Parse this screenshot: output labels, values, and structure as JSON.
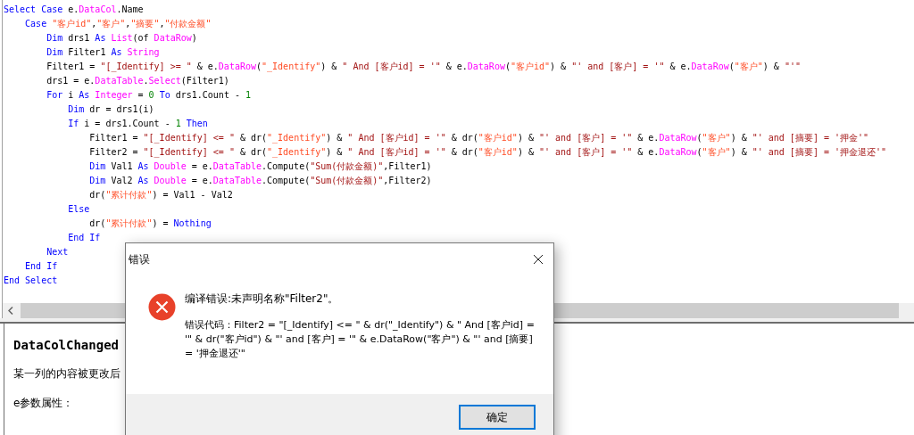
{
  "editor": {
    "lines": [
      {
        "tokens": [
          {
            "kind": "keyword",
            "text": "Select Case"
          },
          {
            "kind": "plain",
            "text": " e."
          },
          {
            "kind": "member",
            "text": "DataCol"
          },
          {
            "kind": "plain",
            "text": ".Name"
          }
        ]
      },
      {
        "tokens": [
          {
            "kind": "keyword",
            "text": "    Case "
          },
          {
            "kind": "string",
            "text": "\"客户id\""
          },
          {
            "kind": "plain",
            "text": ","
          },
          {
            "kind": "string",
            "text": "\"客户\""
          },
          {
            "kind": "plain",
            "text": ","
          },
          {
            "kind": "string",
            "text": "\"摘要\""
          },
          {
            "kind": "plain",
            "text": ","
          },
          {
            "kind": "string",
            "text": "\"付款金额\""
          }
        ]
      },
      {
        "tokens": [
          {
            "kind": "keyword",
            "text": "        Dim"
          },
          {
            "kind": "plain",
            "text": " drs1 "
          },
          {
            "kind": "keyword",
            "text": "As "
          },
          {
            "kind": "member",
            "text": "List"
          },
          {
            "kind": "plain",
            "text": "(of "
          },
          {
            "kind": "member",
            "text": "DataRow"
          },
          {
            "kind": "plain",
            "text": ")"
          }
        ]
      },
      {
        "tokens": [
          {
            "kind": "keyword",
            "text": "        Dim"
          },
          {
            "kind": "plain",
            "text": " Filter1 "
          },
          {
            "kind": "keyword",
            "text": "As "
          },
          {
            "kind": "member",
            "text": "String"
          }
        ]
      },
      {
        "tokens": [
          {
            "kind": "plain",
            "text": "        Filter1 = "
          },
          {
            "kind": "sql",
            "text": "\"[_Identify] >= \""
          },
          {
            "kind": "plain",
            "text": " & e."
          },
          {
            "kind": "member",
            "text": "DataRow"
          },
          {
            "kind": "plain",
            "text": "("
          },
          {
            "kind": "string",
            "text": "\"_Identify\""
          },
          {
            "kind": "plain",
            "text": ") & "
          },
          {
            "kind": "sql",
            "text": "\" And [客户id] = '\""
          },
          {
            "kind": "plain",
            "text": " & e."
          },
          {
            "kind": "member",
            "text": "DataRow"
          },
          {
            "kind": "plain",
            "text": "("
          },
          {
            "kind": "string",
            "text": "\"客户id\""
          },
          {
            "kind": "plain",
            "text": ") & "
          },
          {
            "kind": "sql",
            "text": "\"' and [客户] = '\""
          },
          {
            "kind": "plain",
            "text": " & e."
          },
          {
            "kind": "member",
            "text": "DataRow"
          },
          {
            "kind": "plain",
            "text": "("
          },
          {
            "kind": "string",
            "text": "\"客户\""
          },
          {
            "kind": "plain",
            "text": ") & "
          },
          {
            "kind": "sql",
            "text": "\"'\""
          }
        ]
      },
      {
        "tokens": [
          {
            "kind": "plain",
            "text": "        drs1 = e."
          },
          {
            "kind": "member",
            "text": "DataTable"
          },
          {
            "kind": "plain",
            "text": "."
          },
          {
            "kind": "member",
            "text": "Select"
          },
          {
            "kind": "plain",
            "text": "(Filter1)"
          }
        ]
      },
      {
        "tokens": [
          {
            "kind": "keyword",
            "text": "        For"
          },
          {
            "kind": "plain",
            "text": " i "
          },
          {
            "kind": "keyword",
            "text": "As "
          },
          {
            "kind": "member",
            "text": "Integer"
          },
          {
            "kind": "plain",
            "text": " = "
          },
          {
            "kind": "number",
            "text": "0 "
          },
          {
            "kind": "keyword",
            "text": "To"
          },
          {
            "kind": "plain",
            "text": " drs1.Count - "
          },
          {
            "kind": "number",
            "text": "1"
          }
        ]
      },
      {
        "tokens": [
          {
            "kind": "keyword",
            "text": "            Dim"
          },
          {
            "kind": "plain",
            "text": " dr = drs1(i)"
          }
        ]
      },
      {
        "tokens": [
          {
            "kind": "keyword",
            "text": "            If"
          },
          {
            "kind": "plain",
            "text": " i = drs1.Count - "
          },
          {
            "kind": "number",
            "text": "1 "
          },
          {
            "kind": "keyword",
            "text": "Then"
          }
        ]
      },
      {
        "tokens": [
          {
            "kind": "plain",
            "text": "                Filter1 = "
          },
          {
            "kind": "sql",
            "text": "\"[_Identify] <= \""
          },
          {
            "kind": "plain",
            "text": " & dr("
          },
          {
            "kind": "string",
            "text": "\"_Identify\""
          },
          {
            "kind": "plain",
            "text": ") & "
          },
          {
            "kind": "sql",
            "text": "\" And [客户id] = '\""
          },
          {
            "kind": "plain",
            "text": " & dr("
          },
          {
            "kind": "string",
            "text": "\"客户id\""
          },
          {
            "kind": "plain",
            "text": ") & "
          },
          {
            "kind": "sql",
            "text": "\"' and [客户] = '\""
          },
          {
            "kind": "plain",
            "text": " & e."
          },
          {
            "kind": "member",
            "text": "DataRow"
          },
          {
            "kind": "plain",
            "text": "("
          },
          {
            "kind": "string",
            "text": "\"客户\""
          },
          {
            "kind": "plain",
            "text": ") & "
          },
          {
            "kind": "sql",
            "text": "\"' and [摘要] = '押金'\""
          }
        ]
      },
      {
        "tokens": [
          {
            "kind": "plain",
            "text": "                Filter2 = "
          },
          {
            "kind": "sql",
            "text": "\"[_Identify] <= \""
          },
          {
            "kind": "plain",
            "text": " & dr("
          },
          {
            "kind": "string",
            "text": "\"_Identify\""
          },
          {
            "kind": "plain",
            "text": ") & "
          },
          {
            "kind": "sql",
            "text": "\" And [客户id] = '\""
          },
          {
            "kind": "plain",
            "text": " & dr("
          },
          {
            "kind": "string",
            "text": "\"客户id\""
          },
          {
            "kind": "plain",
            "text": ") & "
          },
          {
            "kind": "sql",
            "text": "\"' and [客户] = '\""
          },
          {
            "kind": "plain",
            "text": " & e."
          },
          {
            "kind": "member",
            "text": "DataRow"
          },
          {
            "kind": "plain",
            "text": "("
          },
          {
            "kind": "string",
            "text": "\"客户\""
          },
          {
            "kind": "plain",
            "text": ") & "
          },
          {
            "kind": "sql",
            "text": "\"' and [摘要] = '押金退还'\""
          }
        ]
      },
      {
        "tokens": [
          {
            "kind": "keyword",
            "text": "                Dim"
          },
          {
            "kind": "plain",
            "text": " Val1 "
          },
          {
            "kind": "keyword",
            "text": "As "
          },
          {
            "kind": "member",
            "text": "Double"
          },
          {
            "kind": "plain",
            "text": " = e."
          },
          {
            "kind": "member",
            "text": "DataTable"
          },
          {
            "kind": "plain",
            "text": ".Compute("
          },
          {
            "kind": "sql",
            "text": "\"Sum(付款金额)\""
          },
          {
            "kind": "plain",
            "text": ",Filter1)"
          }
        ]
      },
      {
        "tokens": [
          {
            "kind": "keyword",
            "text": "                Dim"
          },
          {
            "kind": "plain",
            "text": " Val2 "
          },
          {
            "kind": "keyword",
            "text": "As "
          },
          {
            "kind": "member",
            "text": "Double"
          },
          {
            "kind": "plain",
            "text": " = e."
          },
          {
            "kind": "member",
            "text": "DataTable"
          },
          {
            "kind": "plain",
            "text": ".Compute("
          },
          {
            "kind": "sql",
            "text": "\"Sum(付款金额)\""
          },
          {
            "kind": "plain",
            "text": ",Filter2)"
          }
        ]
      },
      {
        "tokens": [
          {
            "kind": "plain",
            "text": "                dr("
          },
          {
            "kind": "string",
            "text": "\"累计付款\""
          },
          {
            "kind": "plain",
            "text": ") = Val1 - Val2"
          }
        ]
      },
      {
        "tokens": [
          {
            "kind": "keyword",
            "text": "            Else"
          }
        ]
      },
      {
        "tokens": [
          {
            "kind": "plain",
            "text": "                dr("
          },
          {
            "kind": "string",
            "text": "\"累计付款\""
          },
          {
            "kind": "plain",
            "text": ") = "
          },
          {
            "kind": "keyword",
            "text": "Nothing"
          }
        ]
      },
      {
        "tokens": [
          {
            "kind": "keyword",
            "text": "            End If"
          }
        ]
      },
      {
        "tokens": [
          {
            "kind": "keyword",
            "text": "        Next"
          }
        ]
      },
      {
        "tokens": [
          {
            "kind": "keyword",
            "text": "    End If"
          }
        ]
      },
      {
        "tokens": [
          {
            "kind": "keyword",
            "text": "End Select"
          }
        ]
      }
    ]
  },
  "help": {
    "title": "DataColChanged",
    "paragraphs": [
      "某一列的内容被更改后",
      "e参数属性："
    ]
  },
  "dialog": {
    "title": "错误",
    "message": "编译错误:未声明名称\"Filter2\"。",
    "detail": "错误代码：Filter2 = \"[_Identify] <= \" & dr(\"_Identify\") & \" And [客户id] = '\" & dr(\"客户id\") & \"' and [客户] = '\" & e.DataRow(\"客户\") & \"' and [摘要] = '押金退还'\"",
    "buttons": [
      "确定"
    ]
  }
}
